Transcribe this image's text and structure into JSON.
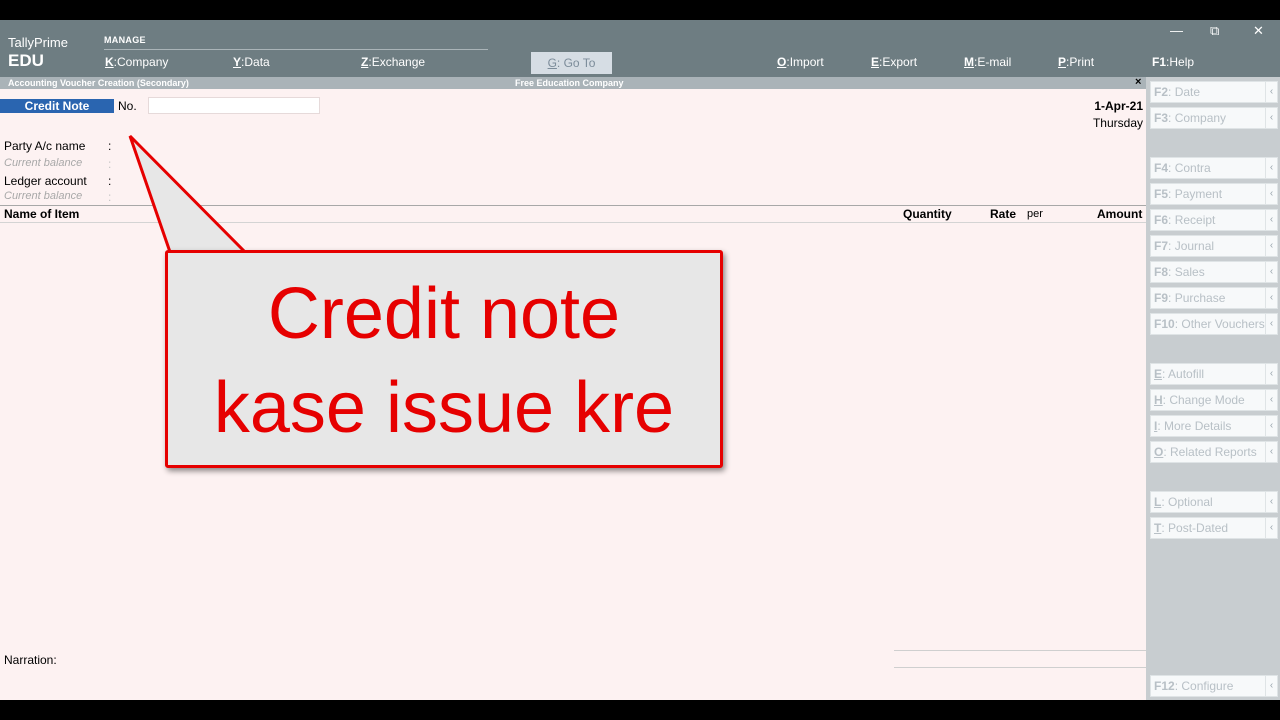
{
  "brand": {
    "line1": "TallyPrime",
    "line2": "EDU"
  },
  "topbar": {
    "manage_label": "MANAGE",
    "menu": [
      {
        "key": "K",
        "label": "Company"
      },
      {
        "key": "Y",
        "label": "Data"
      },
      {
        "key": "Z",
        "label": "Exchange"
      }
    ],
    "goto": {
      "key": "G",
      "label": "Go To"
    },
    "actions": [
      {
        "key": "O",
        "label": "Import"
      },
      {
        "key": "E",
        "label": "Export"
      },
      {
        "key": "M",
        "label": "E-mail"
      },
      {
        "key": "P",
        "label": "Print"
      },
      {
        "key": "F1",
        "label": "Help"
      }
    ]
  },
  "subbar": {
    "title": "Accounting Voucher Creation (Secondary)",
    "company": "Free Education Company",
    "close": "×"
  },
  "voucher": {
    "type": "Credit Note",
    "no_label": "No.",
    "no_value": "",
    "date": "1-Apr-21",
    "day": "Thursday"
  },
  "fields": {
    "party_label": "Party A/c name",
    "party_balance_label": "Current balance",
    "ledger_label": "Ledger account",
    "ledger_balance_label": "Current balance",
    "colon": ":"
  },
  "columns": {
    "item": "Name of Item",
    "quantity": "Quantity",
    "rate": "Rate",
    "per": "per",
    "amount": "Amount"
  },
  "narration_label": "Narration:",
  "callout": {
    "text": "Credit note\nkase issue kre",
    "color": "#e60000"
  },
  "rightpanel": {
    "group1": [
      {
        "key": "F2",
        "label": "Date"
      },
      {
        "key": "F3",
        "label": "Company"
      }
    ],
    "group2": [
      {
        "key": "F4",
        "label": "Contra"
      },
      {
        "key": "F5",
        "label": "Payment"
      },
      {
        "key": "F6",
        "label": "Receipt"
      },
      {
        "key": "F7",
        "label": "Journal"
      },
      {
        "key": "F8",
        "label": "Sales"
      },
      {
        "key": "F9",
        "label": "Purchase"
      },
      {
        "key": "F10",
        "label": "Other Vouchers"
      }
    ],
    "group3": [
      {
        "key": "E",
        "label": "Autofill"
      },
      {
        "key": "H",
        "label": "Change Mode"
      },
      {
        "key": "I",
        "label": "More Details"
      },
      {
        "key": "O",
        "label": "Related Reports"
      }
    ],
    "group4": [
      {
        "key": "L",
        "label": "Optional"
      },
      {
        "key": "T",
        "label": "Post-Dated"
      }
    ],
    "group5": [
      {
        "key": "F12",
        "label": "Configure"
      }
    ],
    "arrow": "‹"
  },
  "window_controls": {
    "minimize": "—",
    "restore": "⧉",
    "close": "✕"
  }
}
